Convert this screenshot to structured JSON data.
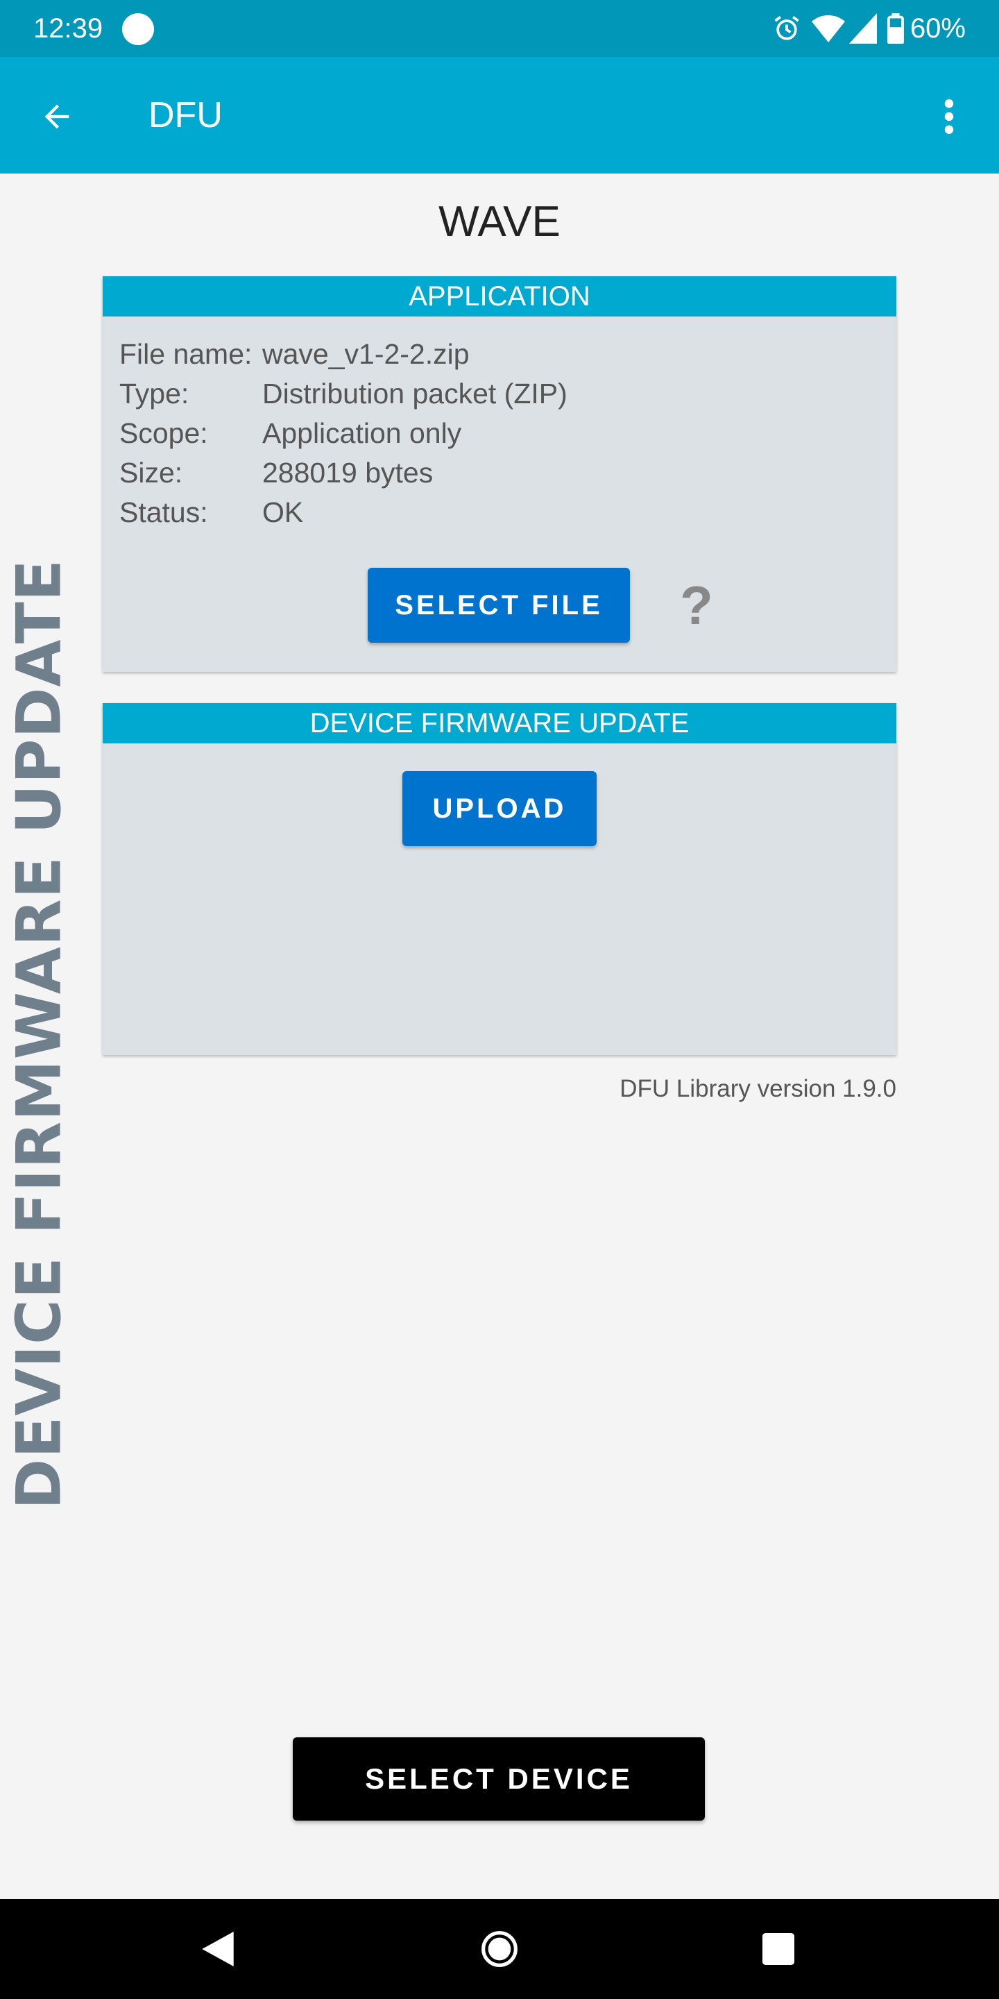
{
  "status_bar": {
    "time": "12:39",
    "battery_percent": "60%",
    "icons": [
      "alarm-icon",
      "wifi-icon",
      "signal-icon",
      "battery-icon"
    ]
  },
  "app_bar": {
    "title": "DFU",
    "back_icon": "arrow-back-icon",
    "menu_icon": "more-vert-icon"
  },
  "side_label": "DEVICE FIRMWARE UPDATE",
  "device_name": "WAVE",
  "application_card": {
    "header": "APPLICATION",
    "rows": [
      {
        "label": "File name:",
        "value": "wave_v1-2-2.zip"
      },
      {
        "label": "Type:",
        "value": "Distribution packet (ZIP)"
      },
      {
        "label": "Scope:",
        "value": "Application only"
      },
      {
        "label": "Size:",
        "value": "288019 bytes"
      },
      {
        "label": "Status:",
        "value": "OK"
      }
    ],
    "select_file_label": "SELECT FILE",
    "help_label": "?"
  },
  "dfu_card": {
    "header": "DEVICE FIRMWARE UPDATE",
    "upload_label": "UPLOAD"
  },
  "library_version": "DFU Library version 1.9.0",
  "select_device_label": "SELECT DEVICE",
  "colors": {
    "status_bar": "#0097b8",
    "app_bar": "#00a9d0",
    "card_bg": "#dbe1e4",
    "primary_button": "#0073cf",
    "side_label": "#6f7f8c"
  }
}
